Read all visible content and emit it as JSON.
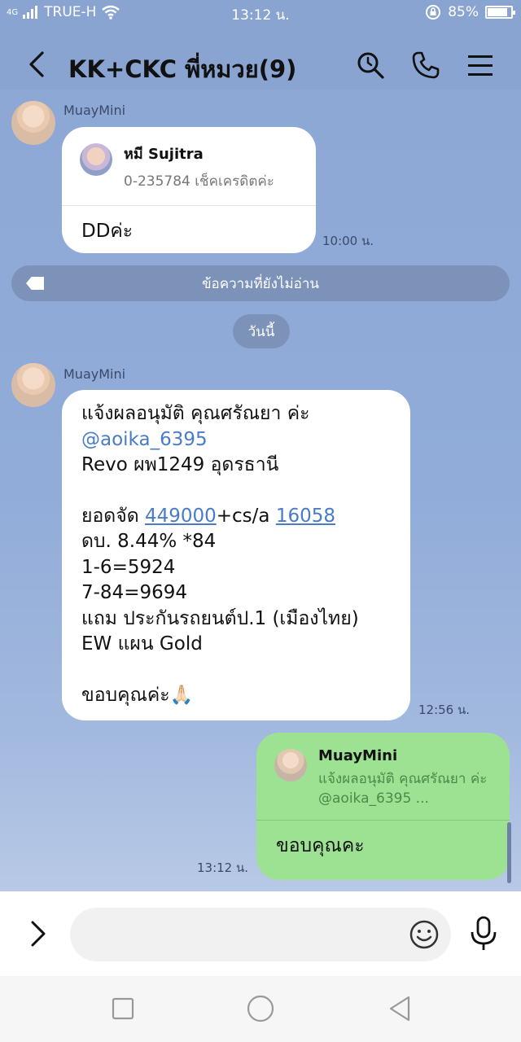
{
  "status_bar": {
    "network": "TRUE-H",
    "network_prefix": "4G",
    "time": "13:12 น.",
    "battery": "85%",
    "battery_level": 0.85
  },
  "header": {
    "title": "KK+CKC พี่หมวย(9)"
  },
  "messages": [
    {
      "sender": "MuayMini",
      "reply": {
        "name": "หมี Sujitra",
        "text": "0-235784 เช็คเครดิตค่ะ"
      },
      "text": "DDค่ะ",
      "time": "10:00 น."
    },
    {
      "sender": "MuayMini",
      "line1": "แจ้งผลอนุมัติ คุณศรัณยา ค่ะ",
      "mention": "@aoika_6395",
      "line3": "Revo ผพ1249 อุดรธานี",
      "amount_prefix": "ยอดจัด ",
      "amount_link": "449000",
      "amount_mid": "+cs/a ",
      "cs_link": "16058",
      "rest": "ดบ. 8.44% *84\n1-6=5924\n7-84=9694\nแถม ประกันรถยนต์ป.1 (เมืองไทย)\nEW แผน Gold",
      "thanks": "ขอบคุณค่ะ🙏🏻",
      "time": "12:56 น."
    },
    {
      "own": true,
      "reply": {
        "name": "MuayMini",
        "text": "แจ้งผลอนุมัติ คุณศรัณยา ค่ะ @aoika_6395 ..."
      },
      "text": "ขอบคุณคะ",
      "time": "13:12 น."
    }
  ],
  "unread_divider": "ข้อความที่ยังไม่อ่าน",
  "day_chip": "วันนี้",
  "input": {
    "placeholder": ""
  },
  "icons": {
    "back": "back-arrow-icon",
    "search": "search-icon",
    "call": "phone-icon",
    "menu": "menu-icon",
    "expand": "chevron-right-icon",
    "emoji": "emoji-icon",
    "mic": "microphone-icon"
  },
  "colors": {
    "chat_bg": "#8fa9d6",
    "own_bubble": "#9de192",
    "link": "#4a7bc9"
  }
}
